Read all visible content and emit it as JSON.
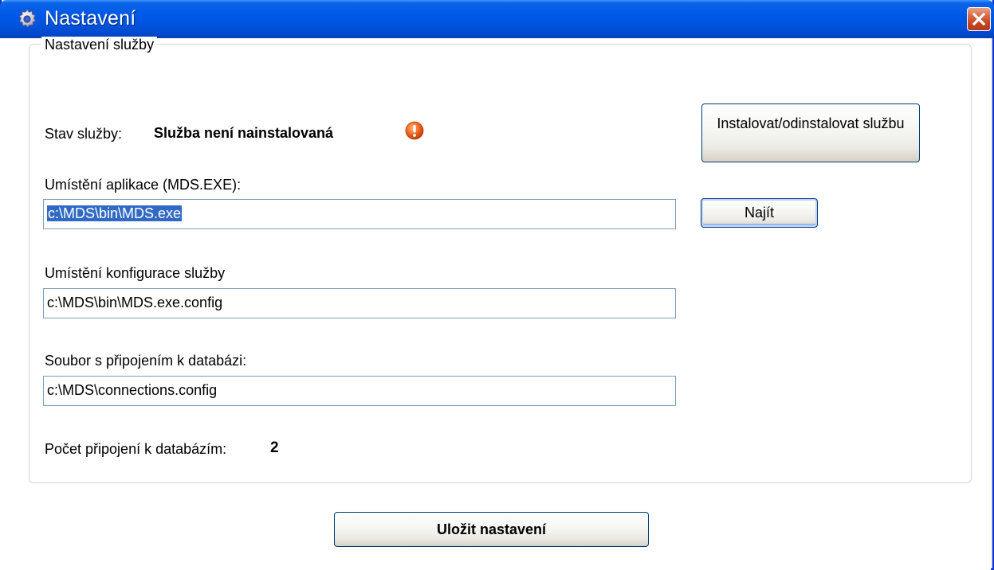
{
  "window": {
    "title": "Nastavení",
    "close_label": "×"
  },
  "group": {
    "legend": "Nastavení služby",
    "status_label": "Stav služby:",
    "status_value": "Služba není nainstalovaná",
    "install_button": "Instalovat/odinstalovat službu",
    "app_path_label": "Umístění aplikace (MDS.EXE):",
    "app_path_value": "c:\\MDS\\bin\\MDS.exe",
    "find_button": "Najít",
    "config_label": "Umístění konfigurace služby",
    "config_value": "c:\\MDS\\bin\\MDS.exe.config",
    "db_file_label": "Soubor s připojením k databázi:",
    "db_file_value": "c:\\MDS\\connections.config",
    "connections_label": "Počet připojení k databázím:",
    "connections_count": "2"
  },
  "footer": {
    "save_button": "Uložit nastavení"
  },
  "icons": {
    "title": "gear-icon",
    "status": "warning-icon",
    "close": "close-icon"
  },
  "colors": {
    "titlebar": "#0058e6",
    "selection": "#316ac5",
    "close_button": "#c44320",
    "warning": "#e85a1c"
  }
}
